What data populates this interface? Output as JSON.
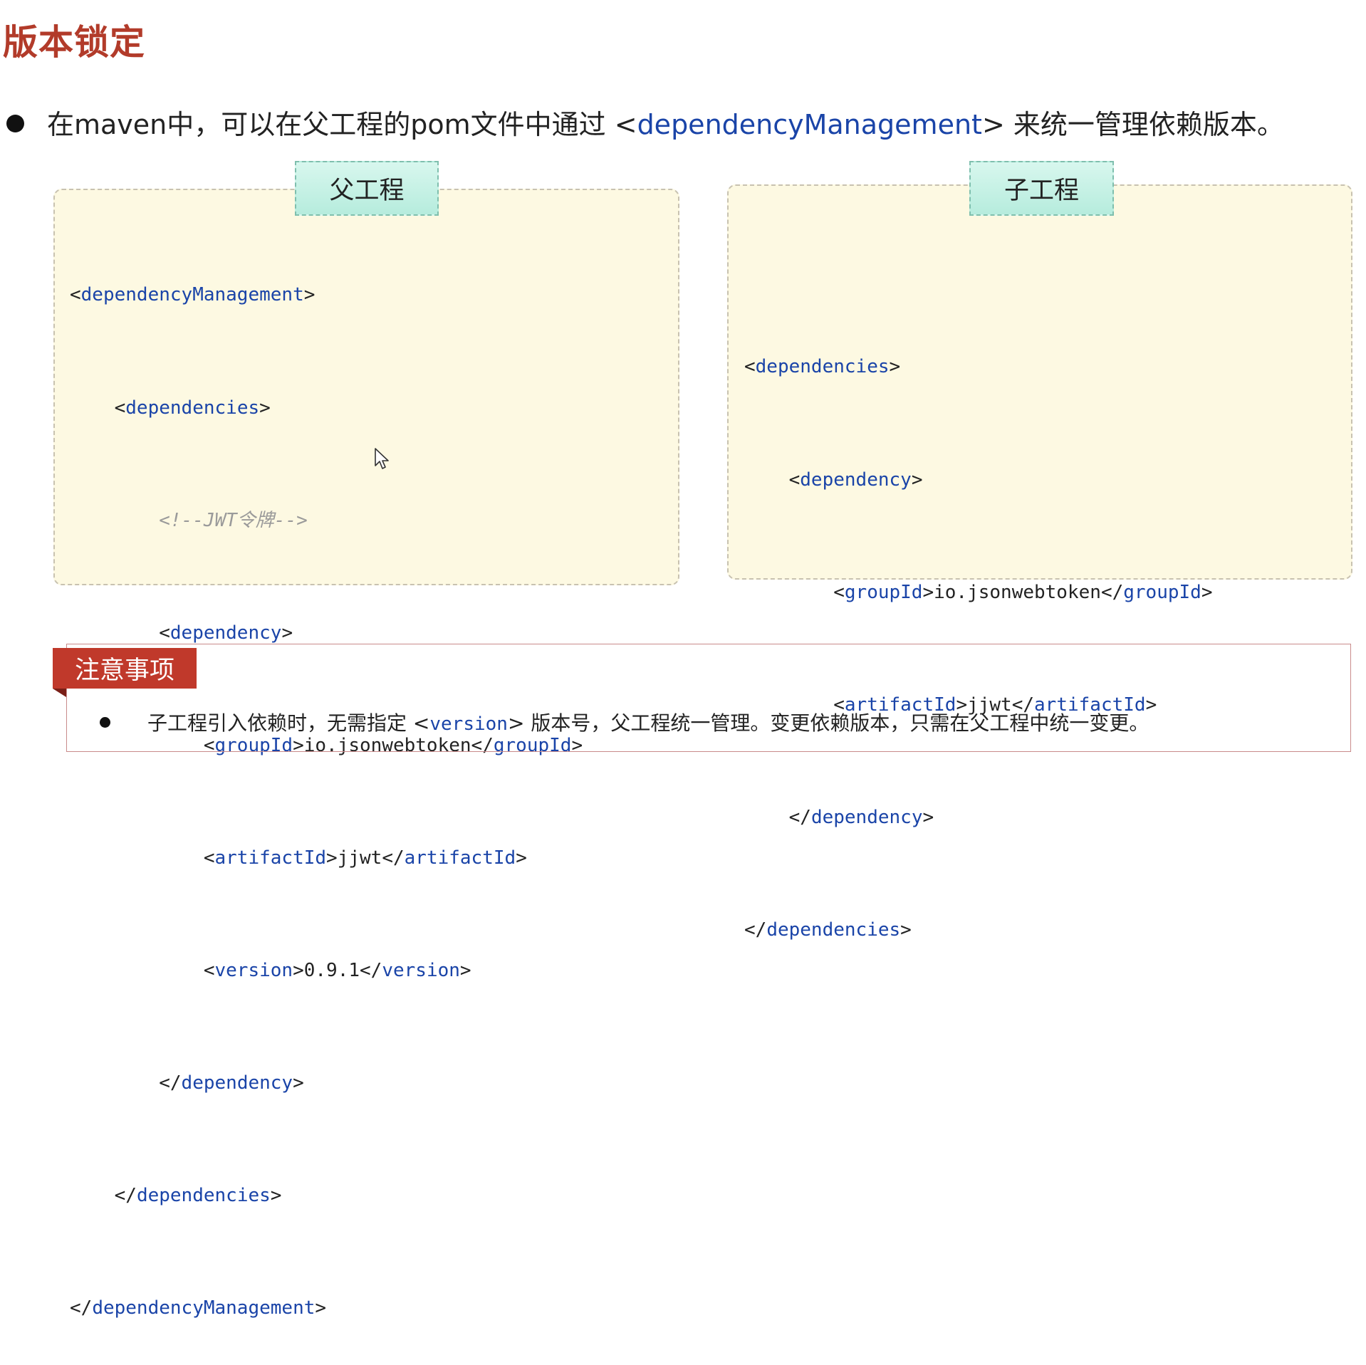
{
  "slide": {
    "title": "版本锁定",
    "bullet": {
      "before": "在maven中，可以在父工程的pom文件中通过 <",
      "keyword": "dependencyManagement",
      "after": "> 来统一管理依赖版本。"
    }
  },
  "parent_panel": {
    "tab_label": "父工程",
    "lines": [
      {
        "lt": "<",
        "name": "dependencyManagement",
        "gt": ">"
      },
      {
        "lt": "<",
        "name": "dependencies",
        "gt": ">"
      },
      {
        "comment": "<!--JWT令牌-->"
      },
      {
        "lt": "<",
        "name": "dependency",
        "gt": ">"
      },
      {
        "open_lt": "<",
        "open": "groupId",
        "open_gt": ">",
        "value": "io.jsonwebtoken",
        "close_lt": "</",
        "close": "groupId",
        "close_gt": ">"
      },
      {
        "open_lt": "<",
        "open": "artifactId",
        "open_gt": ">",
        "value": "jjwt",
        "close_lt": "</",
        "close": "artifactId",
        "close_gt": ">"
      },
      {
        "open_lt": "<",
        "open": "version",
        "open_gt": ">",
        "value": "0.9.1",
        "close_lt": "</",
        "close": "version",
        "close_gt": ">"
      },
      {
        "lt": "</",
        "name": "dependency",
        "gt": ">"
      },
      {
        "lt": "</",
        "name": "dependencies",
        "gt": ">"
      },
      {
        "lt": "</",
        "name": "dependencyManagement",
        "gt": ">"
      }
    ]
  },
  "child_panel": {
    "tab_label": "子工程",
    "lines": [
      {
        "lt": "<",
        "name": "dependencies",
        "gt": ">"
      },
      {
        "lt": "<",
        "name": "dependency",
        "gt": ">"
      },
      {
        "open_lt": "<",
        "open": "groupId",
        "open_gt": ">",
        "value": "io.jsonwebtoken",
        "close_lt": "</",
        "close": "groupId",
        "close_gt": ">"
      },
      {
        "open_lt": "<",
        "open": "artifactId",
        "open_gt": ">",
        "value": "jjwt",
        "close_lt": "</",
        "close": "artifactId",
        "close_gt": ">"
      },
      {
        "lt": "</",
        "name": "dependency",
        "gt": ">"
      },
      {
        "lt": "</",
        "name": "dependencies",
        "gt": ">"
      }
    ]
  },
  "note": {
    "header": "注意事项",
    "text_before": "子工程引入依赖时，无需指定 <",
    "keyword": "version",
    "text_after": "> 版本号，父工程统一管理。变更依赖版本，只需在父工程中统一变更。"
  },
  "colors": {
    "title": "#b23b2a",
    "tag": "#1a44a8",
    "panel_bg": "#fdf9e2",
    "tab_bg": "#c9f2e6",
    "note_header": "#c0392b"
  },
  "icons": {
    "cursor": "mouse-pointer-icon"
  }
}
